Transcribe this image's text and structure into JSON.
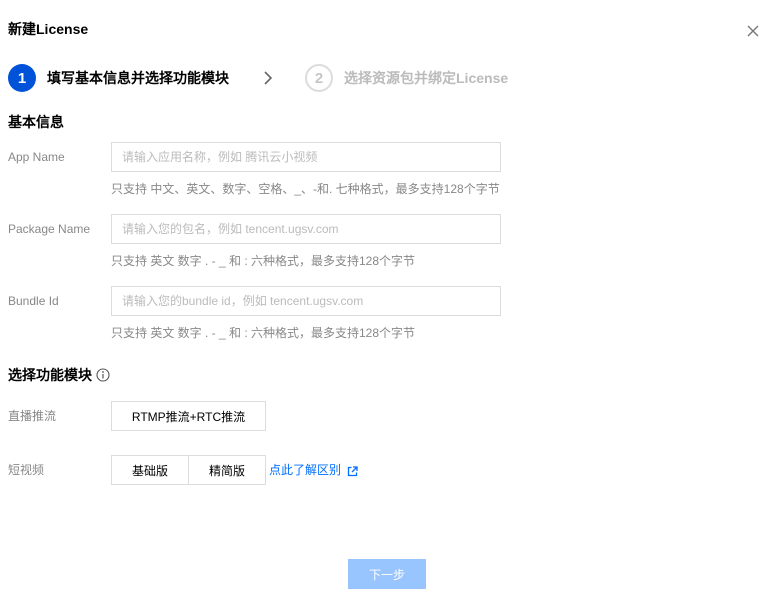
{
  "dialog": {
    "title": "新建License",
    "close_icon": "close-icon"
  },
  "steps": [
    {
      "number": "1",
      "label": "填写基本信息并选择功能模块",
      "state": "active"
    },
    {
      "number": "2",
      "label": "选择资源包并绑定License",
      "state": "inactive"
    }
  ],
  "basic_info": {
    "title": "基本信息",
    "fields": [
      {
        "label": "App Name",
        "placeholder": "请输入应用名称，例如 腾讯云小视频",
        "value": "",
        "hint": "只支持 中文、英文、数字、空格、_、-和. 七种格式，最多支持128个字节"
      },
      {
        "label": "Package Name",
        "placeholder": "请输入您的包名，例如 tencent.ugsv.com",
        "value": "",
        "hint": "只支持 英文 数字 . - _ 和 : 六种格式，最多支持128个字节"
      },
      {
        "label": "Bundle Id",
        "placeholder": "请输入您的bundle id，例如 tencent.ugsv.com",
        "value": "",
        "hint": "只支持 英文 数字 . - _ 和 : 六种格式，最多支持128个字节"
      }
    ]
  },
  "modules": {
    "title": "选择功能模块",
    "info_icon": "info-icon",
    "live": {
      "label": "直播推流",
      "options": [
        "RTMP推流+RTC推流"
      ]
    },
    "short_video": {
      "label": "短视频",
      "options": [
        "基础版",
        "精简版"
      ],
      "link_text": "点此了解区别",
      "link_icon": "external-link-icon"
    }
  },
  "footer": {
    "next_label": "下一步"
  },
  "colors": {
    "accent": "#0052d9",
    "link": "#006eff",
    "disabled_button": "#99c5ff"
  }
}
